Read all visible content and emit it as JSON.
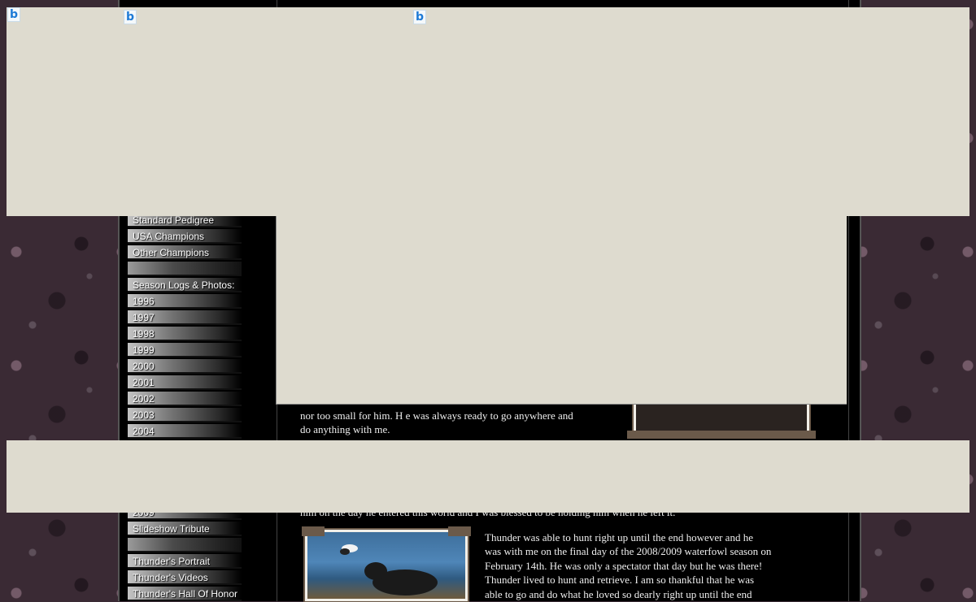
{
  "nav": {
    "items": [
      {
        "label": "Standard Pedigree"
      },
      {
        "label": "USA Champions"
      },
      {
        "label": "Other Champions"
      },
      {
        "label": ""
      },
      {
        "label": "Season Logs & Photos:"
      },
      {
        "label": "1996"
      },
      {
        "label": "1997"
      },
      {
        "label": "1998"
      },
      {
        "label": "1999"
      },
      {
        "label": "2000"
      },
      {
        "label": "2001"
      },
      {
        "label": "2002"
      },
      {
        "label": "2003"
      },
      {
        "label": "2004"
      }
    ],
    "items_lower": [
      {
        "label": "2009"
      },
      {
        "label": "Slideshow Tribute"
      },
      {
        "label": ""
      },
      {
        "label": "Thunder's Portrait"
      },
      {
        "label": "Thunder's Videos"
      },
      {
        "label": "Thunder's Hall Of Honor"
      }
    ]
  },
  "content": {
    "para1_lines": [
      "nor too small for him. H e was always ready to go anywhere and",
      "do anything with me."
    ],
    "partial_line": "him on the day he entered this world and I was blessed to be holding him when he left it.",
    "para2_lines": [
      "Thunder was able to hunt right up until the end however and he",
      "was with me on the final day of the 2008/2009 waterfowl season on",
      "February 14th. He was only a spectator that day but he was there!",
      "Thunder lived to hunt and retrieve. I am so thankful that he was",
      "able to go and do what he loved so dearly right up until the end"
    ]
  },
  "ads": {
    "icon_glyph": "b"
  },
  "colors": {
    "ad_bg": "#dedbcf",
    "page_bg": "#000000",
    "text": "#eeeeee"
  }
}
